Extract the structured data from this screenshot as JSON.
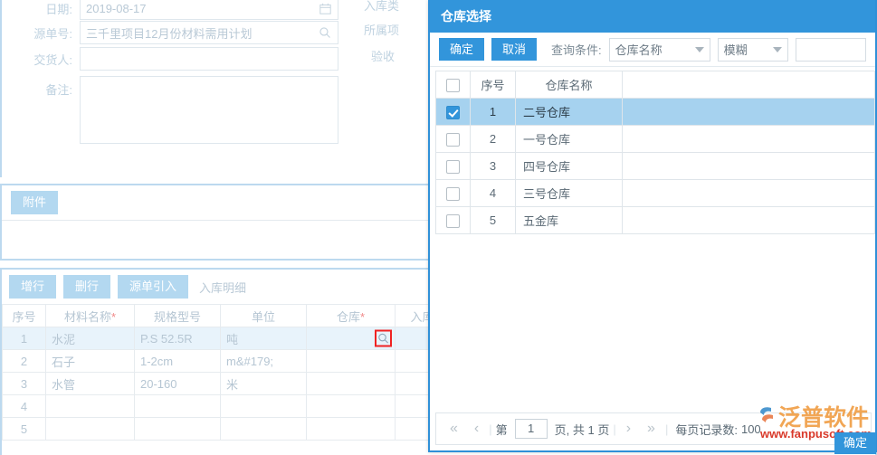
{
  "form": {
    "fields": [
      {
        "label": "日期:",
        "value": "2019-08-17",
        "icon": "calendar-icon"
      },
      {
        "label": "源单号:",
        "value": "三千里项目12月份材料需用计划",
        "icon": "search-icon"
      },
      {
        "label": "交货人:",
        "value": "",
        "icon": ""
      },
      {
        "label": "备注:",
        "value": "",
        "icon": ""
      }
    ],
    "right_labels": [
      {
        "label": "入库类"
      },
      {
        "label": "所属项"
      },
      {
        "label": "验收"
      }
    ]
  },
  "attachment": {
    "button_label": "附件"
  },
  "grid": {
    "buttons": [
      {
        "label": "增行",
        "name": "add-row-button"
      },
      {
        "label": "删行",
        "name": "delete-row-button"
      },
      {
        "label": "源单引入",
        "name": "import-source-button"
      }
    ],
    "tab_label": "入库明细",
    "columns": [
      {
        "label": "序号",
        "required": false
      },
      {
        "label": "材料名称",
        "required": true
      },
      {
        "label": "规格型号",
        "required": false
      },
      {
        "label": "单位",
        "required": false
      },
      {
        "label": "仓库",
        "required": true
      },
      {
        "label": "入库",
        "required": false
      }
    ],
    "rows": [
      {
        "idx": "1",
        "name": "水泥",
        "spec": "P.S 52.5R",
        "unit": "吨",
        "warehouse": "",
        "instock": "",
        "selected": true
      },
      {
        "idx": "2",
        "name": "石子",
        "spec": "1-2cm",
        "unit": "m&#179;",
        "warehouse": "",
        "instock": "",
        "selected": false
      },
      {
        "idx": "3",
        "name": "水管",
        "spec": "20-160",
        "unit": "米",
        "warehouse": "",
        "instock": "",
        "selected": false
      },
      {
        "idx": "4",
        "name": "",
        "spec": "",
        "unit": "",
        "warehouse": "",
        "instock": "",
        "selected": false
      },
      {
        "idx": "5",
        "name": "",
        "spec": "",
        "unit": "",
        "warehouse": "",
        "instock": "",
        "selected": false
      }
    ]
  },
  "dialog": {
    "title": "仓库选择",
    "confirm_label": "确定",
    "cancel_label": "取消",
    "condition_label": "查询条件:",
    "field_select": "仓库名称",
    "match_select": "模糊",
    "keyword_value": "",
    "keyword_placeholder": "",
    "table": {
      "columns": [
        "序号",
        "仓库名称",
        ""
      ],
      "rows": [
        {
          "checked": true,
          "idx": "1",
          "name": "二号仓库",
          "extra": ""
        },
        {
          "checked": false,
          "idx": "2",
          "name": "一号仓库",
          "extra": ""
        },
        {
          "checked": false,
          "idx": "3",
          "name": "四号仓库",
          "extra": ""
        },
        {
          "checked": false,
          "idx": "4",
          "name": "三号仓库",
          "extra": ""
        },
        {
          "checked": false,
          "idx": "5",
          "name": "五金库",
          "extra": ""
        }
      ]
    },
    "pagination": {
      "first": "«",
      "prev": "‹",
      "page_prefix": "第",
      "page_value": "1",
      "page_suffix": "页, 共 1 页",
      "next": "›",
      "last": "»",
      "per_page_label": "每页记录数:",
      "per_page_value": "100"
    },
    "footer_ok_label": "确定"
  },
  "watermark": {
    "brand": "泛普软件",
    "url": "www.fanpusoft.com",
    "brand_color": "#f09a3e",
    "url_color": "#d93a2b"
  },
  "colors": {
    "primary": "#3295db",
    "header": "#3295db",
    "selected_row": "#a6d2ef",
    "soft_button": "#b3d8f0",
    "panel_border": "#bcd9ef"
  }
}
